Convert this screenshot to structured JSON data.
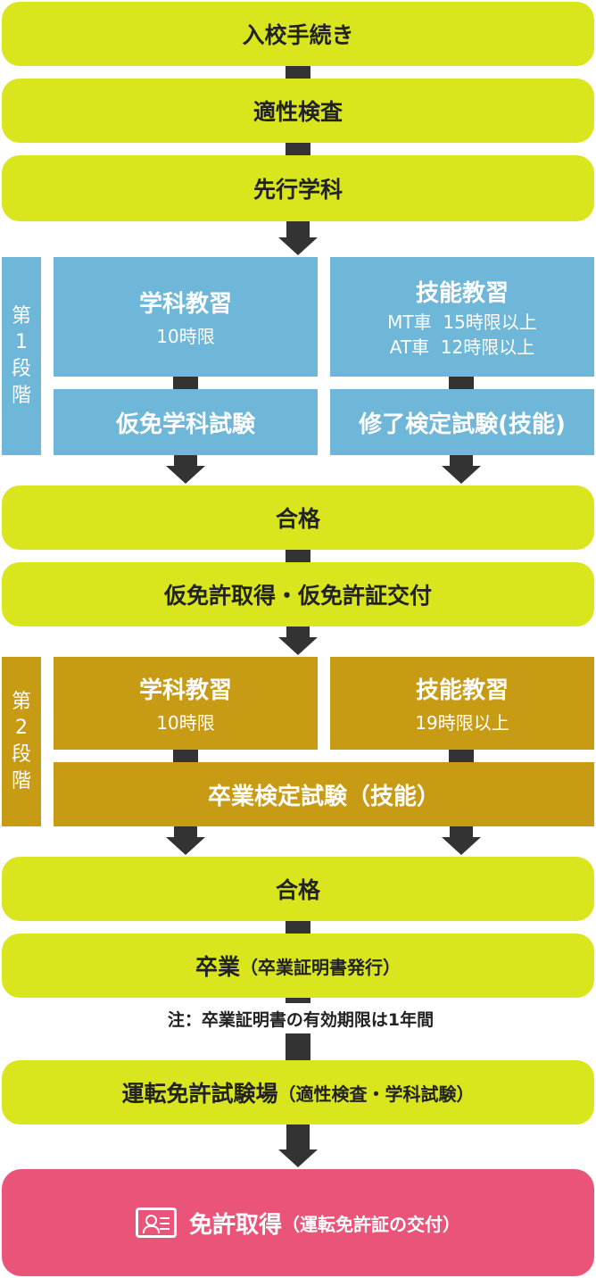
{
  "steps": {
    "admission": "入校手続き",
    "aptitude": "適性検査",
    "pre_study": "先行学科",
    "pass1": "合格",
    "provisional": "仮免許取得・仮免許証交付",
    "pass2": "合格",
    "graduation_main": "卒業",
    "graduation_paren": "（卒業証明書発行）",
    "note": "注：卒業証明書の有効期限は1年間",
    "center_main": "運転免許試験場",
    "center_paren": "（適性検査・学科試験）",
    "final_main": "免許取得",
    "final_paren": "（運転免許証の交付）"
  },
  "stage1": {
    "label_chars": [
      "第",
      "1",
      "段",
      "階"
    ],
    "theory_title": "学科教習",
    "theory_hours": "10時限",
    "skill_title": "技能教習",
    "skill_mt": "MT車  15時限以上",
    "skill_at": "AT車  12時限以上",
    "theory_exam": "仮免学科試験",
    "skill_exam": "修了検定試験(技能)"
  },
  "stage2": {
    "label_chars": [
      "第",
      "2",
      "段",
      "階"
    ],
    "theory_title": "学科教習",
    "theory_hours": "10時限",
    "skill_title": "技能教習",
    "skill_hours": "19時限以上",
    "exam": "卒業検定試験（技能）"
  },
  "colors": {
    "step": "#d9e51d",
    "stage1": "#6eb7d8",
    "stage2": "#c89b15",
    "final": "#ea5479",
    "connector": "#333333"
  },
  "icons": {
    "final": "license-card-icon"
  }
}
